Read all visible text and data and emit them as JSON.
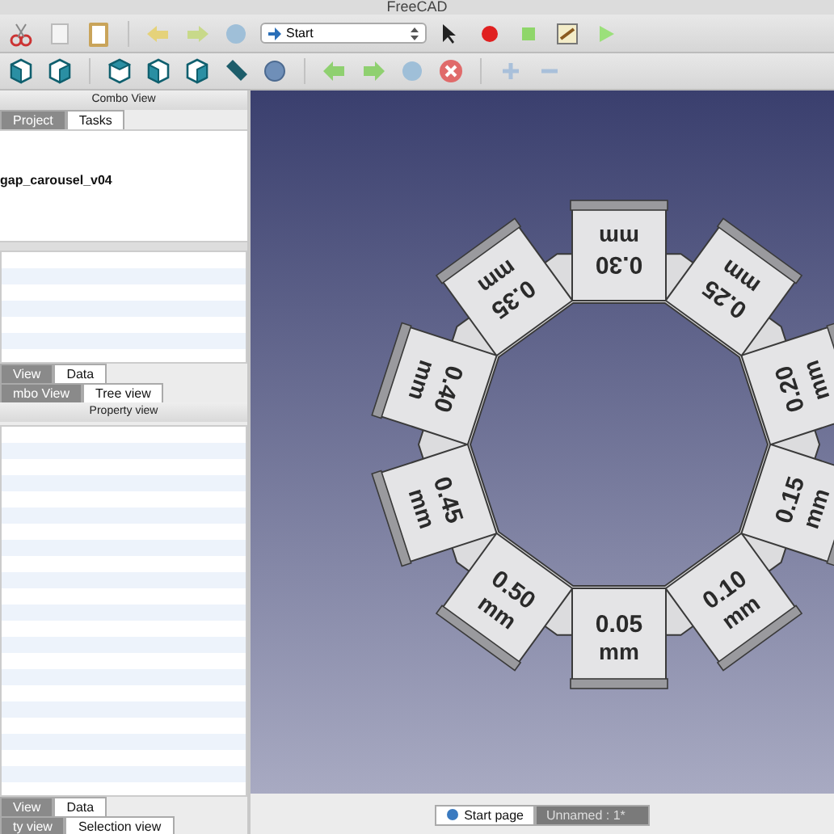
{
  "window": {
    "title": "FreeCAD"
  },
  "toolbar": {
    "workbench": "Start"
  },
  "combo_view": {
    "title": "Combo View",
    "tabs": [
      {
        "label": "Project",
        "selected": true
      },
      {
        "label": "Tasks",
        "selected": false
      }
    ],
    "tree": [
      {
        "label": "gap_carousel_v04"
      }
    ],
    "property_tabs": [
      {
        "label": "View",
        "selected": true
      },
      {
        "label": "Data",
        "selected": false
      }
    ],
    "panel_tabs": [
      {
        "label": "mbo View",
        "selected": true
      },
      {
        "label": "Tree view",
        "selected": false
      }
    ]
  },
  "property_view": {
    "title": "Property view",
    "property_tabs": [
      {
        "label": "View",
        "selected": true
      },
      {
        "label": "Data",
        "selected": false
      }
    ],
    "panel_tabs": [
      {
        "label": "ty view",
        "selected": true
      },
      {
        "label": "Selection view",
        "selected": false
      }
    ]
  },
  "viewport": {
    "tiles": [
      {
        "value": "0.05",
        "unit": "mm"
      },
      {
        "value": "0.10",
        "unit": "mm"
      },
      {
        "value": "0.15",
        "unit": "mm"
      },
      {
        "value": "0.20",
        "unit": "mm"
      },
      {
        "value": "0.25",
        "unit": "mm"
      },
      {
        "value": "0.30",
        "unit": "mm"
      },
      {
        "value": "0.35",
        "unit": "mm"
      },
      {
        "value": "0.40",
        "unit": "mm"
      },
      {
        "value": "0.45",
        "unit": "mm"
      },
      {
        "value": "0.50",
        "unit": "mm"
      }
    ]
  },
  "document_tabs": [
    {
      "label": "Start page",
      "selected": false
    },
    {
      "label": "Unnamed : 1*",
      "selected": true
    }
  ]
}
